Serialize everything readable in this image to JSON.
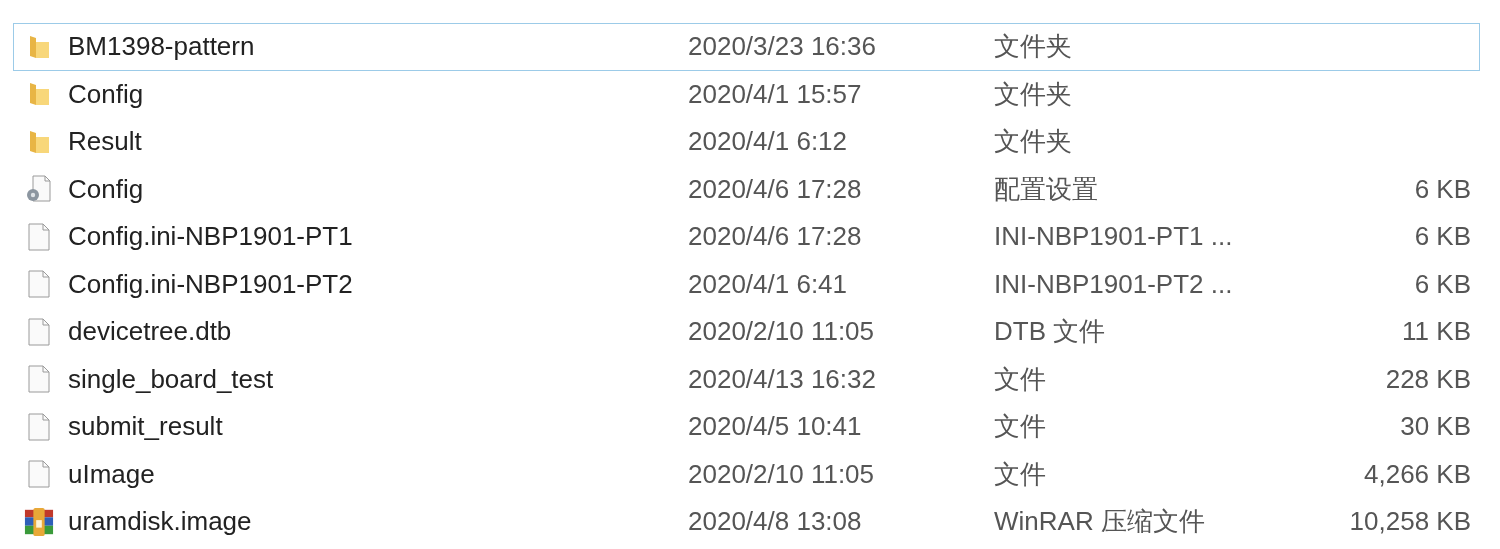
{
  "files": [
    {
      "kind": "folder",
      "name": "BM1398-pattern",
      "modified": "2020/3/23 16:36",
      "type": "文件夹",
      "focused": true
    },
    {
      "kind": "folder",
      "name": "Config",
      "modified": "2020/4/1 15:57",
      "type": "文件夹",
      "focused": false
    },
    {
      "kind": "folder",
      "name": "Result",
      "modified": "2020/4/1 6:12",
      "type": "文件夹",
      "focused": false
    },
    {
      "kind": "settings",
      "name": "Config",
      "modified": "2020/4/6 17:28",
      "type": "配置设置",
      "size": "6 KB",
      "focused": false
    },
    {
      "kind": "file",
      "name": "Config.ini-NBP1901-PT1",
      "modified": "2020/4/6 17:28",
      "type": "INI-NBP1901-PT1 ...",
      "size": "6 KB",
      "focused": false
    },
    {
      "kind": "file",
      "name": "Config.ini-NBP1901-PT2",
      "modified": "2020/4/1 6:41",
      "type": "INI-NBP1901-PT2 ...",
      "size": "6 KB",
      "focused": false
    },
    {
      "kind": "file",
      "name": "devicetree.dtb",
      "modified": "2020/2/10 11:05",
      "type": "DTB 文件",
      "size": "11 KB",
      "focused": false
    },
    {
      "kind": "file",
      "name": "single_board_test",
      "modified": "2020/4/13 16:32",
      "type": "文件",
      "size": "228 KB",
      "focused": false
    },
    {
      "kind": "file",
      "name": "submit_result",
      "modified": "2020/4/5 10:41",
      "type": "文件",
      "size": "30 KB",
      "focused": false
    },
    {
      "kind": "file",
      "name": "uImage",
      "modified": "2020/2/10 11:05",
      "type": "文件",
      "size": "4,266 KB",
      "focused": false
    },
    {
      "kind": "archive",
      "name": "uramdisk.image",
      "modified": "2020/4/8 13:08",
      "type": "WinRAR 压缩文件",
      "size": "10,258 KB",
      "focused": false
    }
  ]
}
